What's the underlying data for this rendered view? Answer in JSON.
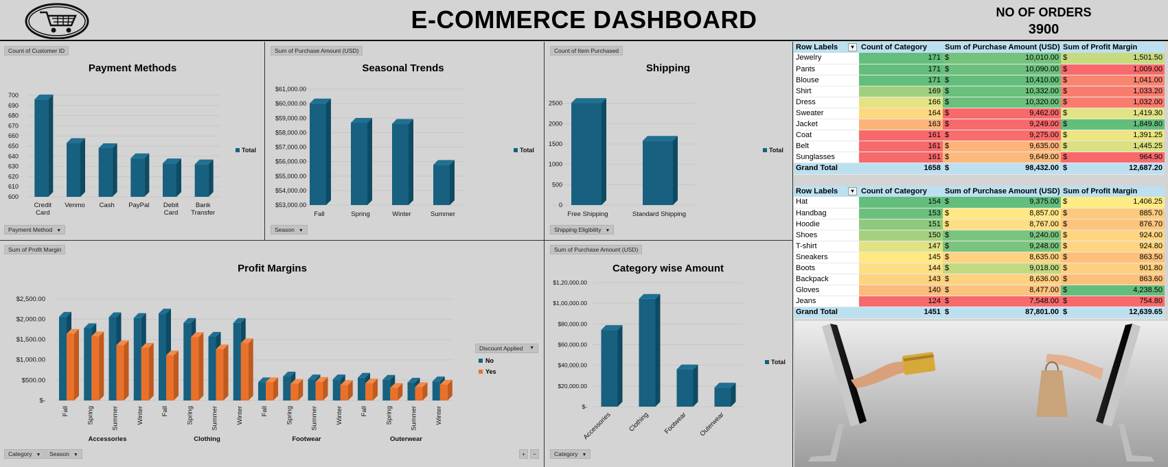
{
  "header": {
    "title": "E-COMMERCE DASHBOARD",
    "orders_label": "NO OF ORDERS",
    "orders_value": "3900"
  },
  "panels": {
    "payment": {
      "field": "Count of Customer ID",
      "title": "Payment Methods",
      "legend": "Total",
      "filter": "Payment Method"
    },
    "season": {
      "field": "Sum of Purchase Amount (USD)",
      "title": "Seasonal Trends",
      "legend": "Total",
      "filter": "Season"
    },
    "shipping": {
      "field": "Count of Item Purchased",
      "title": "Shipping",
      "legend": "Total",
      "filter": "Shipping Eligibility"
    },
    "profit": {
      "field": "Sum of Profit Margin",
      "title": "Profit Margins",
      "legend_title": "Discount Applied",
      "legend_no": "No",
      "legend_yes": "Yes",
      "filter_category": "Category",
      "filter_season": "Season",
      "expand": "+",
      "collapse": "−"
    },
    "category": {
      "field": "Sum of Purchase Amount (USD)",
      "title": "Category wise Amount",
      "legend": "Total",
      "filter": "Category"
    }
  },
  "colors": {
    "bar_blue": "#17607f",
    "bar_blue_side": "#0d4a63",
    "bar_blue_top": "#1f7092",
    "bar_orange": "#e9712b",
    "bar_orange_side": "#c05a1d",
    "bar_orange_top": "#f28a4a"
  },
  "chart_data": [
    {
      "id": "payment",
      "type": "bar",
      "title": "Payment Methods",
      "categories": [
        "Credit\nCard",
        "Venmo",
        "Cash",
        "PayPal",
        "Debit\nCard",
        "Bank\nTransfer"
      ],
      "series": [
        {
          "name": "Total",
          "values": [
            696,
            653,
            648,
            638,
            633,
            632
          ]
        }
      ],
      "ylim": [
        600,
        700
      ],
      "yticks": [
        "700",
        "690",
        "680",
        "670",
        "660",
        "650",
        "640",
        "630",
        "620",
        "610",
        "600"
      ],
      "legend_placement": "right",
      "grid": true
    },
    {
      "id": "season",
      "type": "bar",
      "title": "Seasonal Trends",
      "categories": [
        "Fall",
        "Spring",
        "Winter",
        "Summer"
      ],
      "series": [
        {
          "name": "Total",
          "values": [
            60018,
            58679,
            58607,
            55777
          ]
        }
      ],
      "ylim": [
        53000,
        61000
      ],
      "yticks": [
        "$61,000.00",
        "$60,000.00",
        "$59,000.00",
        "$58,000.00",
        "$57,000.00",
        "$56,000.00",
        "$55,000.00",
        "$54,000.00",
        "$53,000.00"
      ],
      "legend_placement": "right",
      "grid": true
    },
    {
      "id": "shipping",
      "type": "bar",
      "title": "Shipping",
      "categories": [
        "Free Shipping",
        "Standard Shipping"
      ],
      "series": [
        {
          "name": "Total",
          "values": [
            2510,
            1580
          ]
        }
      ],
      "ylim": [
        0,
        3000
      ],
      "yticks": [
        "2500",
        "2000",
        "1500",
        "1000",
        "500",
        "0"
      ],
      "legend_placement": "right",
      "grid": true
    },
    {
      "id": "profit",
      "type": "bar",
      "title": "Profit Margins",
      "groups": [
        "Accessories",
        "Clothing",
        "Footwear",
        "Outerwear"
      ],
      "categories": [
        "Fall",
        "Spring",
        "Summer",
        "Winter",
        "Fall",
        "Spring",
        "Summer",
        "Winter",
        "Fall",
        "Spring",
        "Summer",
        "Winter",
        "Fall",
        "Spring",
        "Summer",
        "Winter"
      ],
      "series": [
        {
          "name": "No",
          "values": [
            2060,
            1780,
            2050,
            2030,
            2140,
            1910,
            1570,
            1910,
            450,
            590,
            520,
            520,
            560,
            510,
            440,
            470
          ]
        },
        {
          "name": "Yes",
          "values": [
            1640,
            1580,
            1360,
            1300,
            1110,
            1560,
            1260,
            1410,
            450,
            410,
            460,
            380,
            420,
            310,
            330,
            390
          ]
        }
      ],
      "ylim": [
        0,
        2750
      ],
      "yticks": [
        "$2,500.00",
        "$2,000.00",
        "$1,500.00",
        "$1,000.00",
        "$500.00",
        "$-"
      ],
      "legend_placement": "right",
      "grid": true
    },
    {
      "id": "category",
      "type": "bar",
      "title": "Category wise Amount",
      "categories": [
        "Accessories",
        "Clothing",
        "Footwear",
        "Outerwear"
      ],
      "series": [
        {
          "name": "Total",
          "values": [
            74200,
            104300,
            36100,
            18500
          ]
        }
      ],
      "ylim": [
        0,
        130000
      ],
      "yticks": [
        "$1,20,000.00",
        "$1,00,000.00",
        "$80,000.00",
        "$60,000.00",
        "$40,000.00",
        "$20,000.00",
        "$-"
      ],
      "legend_placement": "right",
      "grid": true
    },
    {
      "id": "table-top",
      "type": "table",
      "columns": [
        "Row Labels",
        "Count of Category",
        "Sum of Purchase Amount (USD)",
        "Sum of Profit Margin"
      ],
      "rows": [
        {
          "label": "Jewelry",
          "count": "171",
          "amount": "10,010.00",
          "profit": "1,501.50",
          "c_count": "#63be7b",
          "c_amount": "#74c27c",
          "c_profit": "#c7da80"
        },
        {
          "label": "Pants",
          "count": "171",
          "amount": "10,090.00",
          "profit": "1,009.00",
          "c_count": "#63be7b",
          "c_amount": "#6cc07c",
          "c_profit": "#f8696b"
        },
        {
          "label": "Blouse",
          "count": "171",
          "amount": "10,410.00",
          "profit": "1,041.00",
          "c_count": "#63be7b",
          "c_amount": "#63be7b",
          "c_profit": "#f98570"
        },
        {
          "label": "Shirt",
          "count": "169",
          "amount": "10,332.00",
          "profit": "1,033.20",
          "c_count": "#9fd07f",
          "c_amount": "#6ac07c",
          "c_profit": "#f97d6e"
        },
        {
          "label": "Dress",
          "count": "166",
          "amount": "10,320.00",
          "profit": "1,032.00",
          "c_count": "#e3e383",
          "c_amount": "#6bc07c",
          "c_profit": "#f97c6e"
        },
        {
          "label": "Sweater",
          "count": "164",
          "amount": "9,462.00",
          "profit": "1,419.30",
          "c_count": "#fed880",
          "c_amount": "#f8696b",
          "c_profit": "#e2e383"
        },
        {
          "label": "Jacket",
          "count": "163",
          "amount": "9,249.00",
          "profit": "1,849.80",
          "c_count": "#fcb479",
          "c_amount": "#f8696b",
          "c_profit": "#63be7b"
        },
        {
          "label": "Coat",
          "count": "161",
          "amount": "9,275.00",
          "profit": "1,391.25",
          "c_count": "#f8696b",
          "c_amount": "#f96d6c",
          "c_profit": "#ebe582"
        },
        {
          "label": "Belt",
          "count": "161",
          "amount": "9,635.00",
          "profit": "1,445.25",
          "c_count": "#f8696b",
          "c_amount": "#fcb479",
          "c_profit": "#dbe081"
        },
        {
          "label": "Sunglasses",
          "count": "161",
          "amount": "9,649.00",
          "profit": "964.90",
          "c_count": "#f8696b",
          "c_amount": "#fcb97a",
          "c_profit": "#f8696b"
        }
      ],
      "total": {
        "label": "Grand Total",
        "count": "1658",
        "amount": "98,432.00",
        "profit": "12,687.20"
      }
    },
    {
      "id": "table-bottom",
      "type": "table",
      "columns": [
        "Row Labels",
        "Count of Category",
        "Sum of Purchase Amount (USD)",
        "Sum of Profit Margin"
      ],
      "rows": [
        {
          "label": "Hat",
          "count": "154",
          "amount": "9,375.00",
          "profit": "1,406.25",
          "c_count": "#63be7b",
          "c_amount": "#63be7b",
          "c_profit": "#ffeb84"
        },
        {
          "label": "Handbag",
          "count": "153",
          "amount": "8,857.00",
          "profit": "885.70",
          "c_count": "#6cc07c",
          "c_amount": "#ffe884",
          "c_profit": "#fdca7d"
        },
        {
          "label": "Hoodie",
          "count": "151",
          "amount": "8,767.00",
          "profit": "876.70",
          "c_count": "#8dca7e",
          "c_amount": "#fede83",
          "c_profit": "#fdc57c"
        },
        {
          "label": "Shoes",
          "count": "150",
          "amount": "9,240.00",
          "profit": "924.00",
          "c_count": "#a5d17f",
          "c_amount": "#7bc47d",
          "c_profit": "#fed580"
        },
        {
          "label": "T-shirt",
          "count": "147",
          "amount": "9,248.00",
          "profit": "924.80",
          "c_count": "#e0e283",
          "c_amount": "#7ac47d",
          "c_profit": "#fed580"
        },
        {
          "label": "Sneakers",
          "count": "145",
          "amount": "8,635.00",
          "profit": "863.50",
          "c_count": "#fee983",
          "c_amount": "#fed27f",
          "c_profit": "#fdc07b"
        },
        {
          "label": "Boots",
          "count": "144",
          "amount": "9,018.00",
          "profit": "901.80",
          "c_count": "#fede82",
          "c_amount": "#c3d980",
          "c_profit": "#fdcf7e"
        },
        {
          "label": "Backpack",
          "count": "143",
          "amount": "8,636.00",
          "profit": "863.60",
          "c_count": "#fed380",
          "c_amount": "#fed27f",
          "c_profit": "#fdc07b"
        },
        {
          "label": "Gloves",
          "count": "140",
          "amount": "8,477.00",
          "profit": "4,238.50",
          "c_count": "#fcbb7a",
          "c_amount": "#fdc27b",
          "c_profit": "#63be7b"
        },
        {
          "label": "Jeans",
          "count": "124",
          "amount": "7,548.00",
          "profit": "754.80",
          "c_count": "#f8696b",
          "c_amount": "#f8696b",
          "c_profit": "#f8696b"
        }
      ],
      "total": {
        "label": "Grand Total",
        "count": "1451",
        "amount": "87,801.00",
        "profit": "12,639.65"
      }
    }
  ]
}
